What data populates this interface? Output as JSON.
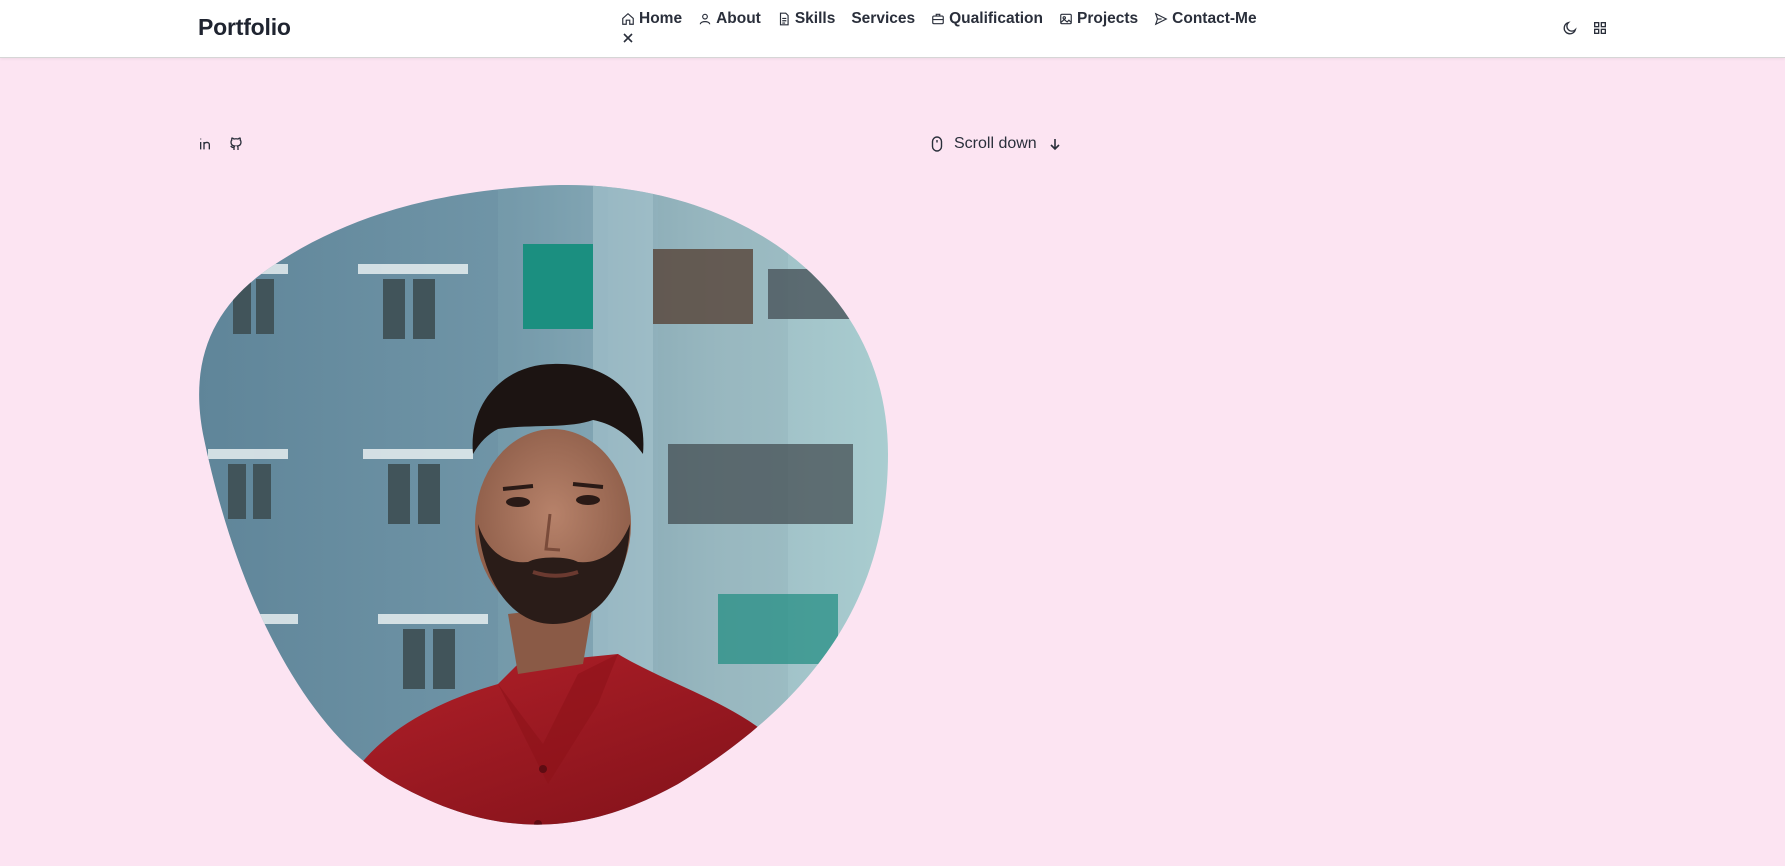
{
  "header": {
    "logo": "Portfolio",
    "nav": [
      {
        "label": "Home",
        "icon": "home-icon"
      },
      {
        "label": "About",
        "icon": "user-icon"
      },
      {
        "label": "Skills",
        "icon": "file-icon"
      },
      {
        "label": "Services",
        "icon": ""
      },
      {
        "label": "Qualification",
        "icon": "briefcase-icon"
      },
      {
        "label": "Projects",
        "icon": "image-icon"
      },
      {
        "label": "Contact-Me",
        "icon": "send-icon"
      }
    ],
    "close_icon": "close-icon",
    "actions": [
      "moon-icon",
      "apps-grid-icon"
    ]
  },
  "hero": {
    "social": [
      "linkedin-icon",
      "github-icon"
    ],
    "scroll": {
      "label": "Scroll down",
      "icons": [
        "mouse-icon",
        "arrow-down-icon"
      ]
    },
    "photo": "profile-photo"
  },
  "colors": {
    "background": "#fce4f2",
    "header": "#ffffff",
    "text": "#1f2430",
    "shirt": "#a81c24",
    "building": "#6f93a6"
  }
}
